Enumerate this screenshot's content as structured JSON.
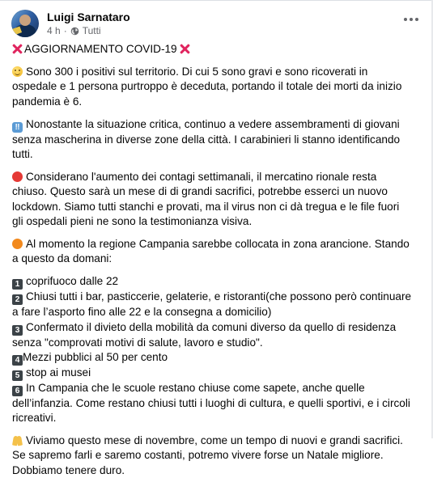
{
  "post": {
    "author": "Luigi Sarnataro",
    "time": "4 h",
    "separator": "·",
    "audience": "Tutti"
  },
  "icons": {
    "avatar": "profile-avatar",
    "audience": "globe-icon",
    "more": "more-options-icon",
    "x": "red-x-emoji",
    "smile": "grinning-face-emoji",
    "double_exclamation": "double-exclamation-emoji",
    "red_circle": "red-circle-emoji",
    "orange_circle": "orange-circle-emoji",
    "keycap": "keycap-number-emoji",
    "pray": "folded-hands-emoji"
  },
  "content": {
    "title": "AGGIORNAMENTO COVID-19",
    "p1": [
      "Sono 300 i positivi sul territorio. Di cui 5 sono gravi e sono ricoverati in",
      "ospedale e 1 persona purtroppo è deceduta, portando il totale dei morti da inizio",
      "pandemia è 6."
    ],
    "p2": [
      "Nonostante la situazione critica, continuo a vedere assembramenti di giovani",
      "senza mascherina in diverse zone della città. I carabinieri li stanno identificando",
      "tutti."
    ],
    "p3": [
      "Considerano l'aumento dei contagi settimanali, il mercatino rionale resta",
      "chiuso. Questo sarà un mese di di grandi sacrifici, potrebbe esserci un nuovo",
      "lockdown. Siamo tutti stanchi e provati, ma il virus non ci dà tregua e le file fuori",
      "gli ospedali pieni ne sono la testimonianza visiva."
    ],
    "p4": [
      "Al momento la regione Campania sarebbe collocata in zona arancione. Stando",
      "a questo da domani:"
    ],
    "list": [
      {
        "num": "1",
        "lines": [
          "coprifuoco dalle 22"
        ]
      },
      {
        "num": "2",
        "lines": [
          "Chiusi tutti i bar, pasticcerie, gelaterie, e ristoranti(che possono però continuare",
          "a fare l’asporto fino alle 22 e la consegna a domicilio)"
        ]
      },
      {
        "num": "3",
        "lines": [
          "Confermato il divieto della mobilità da comuni diverso da quello di residenza",
          "senza \"comprovati  motivi di salute, lavoro e studio\"."
        ]
      },
      {
        "num": "4",
        "lines": [
          "Mezzi pubblici al 50 per cento"
        ]
      },
      {
        "num": "5",
        "lines": [
          "stop ai musei"
        ]
      },
      {
        "num": "6",
        "lines": [
          "In Campania che le scuole restano chiuse come sapete, anche quelle",
          "dell’infanzia. Come restano chiusi tutti i luoghi di cultura, e quelli sportivi, e i circoli",
          "ricreativi."
        ]
      }
    ],
    "p5": [
      "Viviamo questo mese di novembre, come un tempo di nuovi e grandi sacrifici.",
      "Se sapremo farli e saremo costanti, potremo vivere forse un Natale migliore.",
      "Dobbiamo tenere duro."
    ]
  }
}
